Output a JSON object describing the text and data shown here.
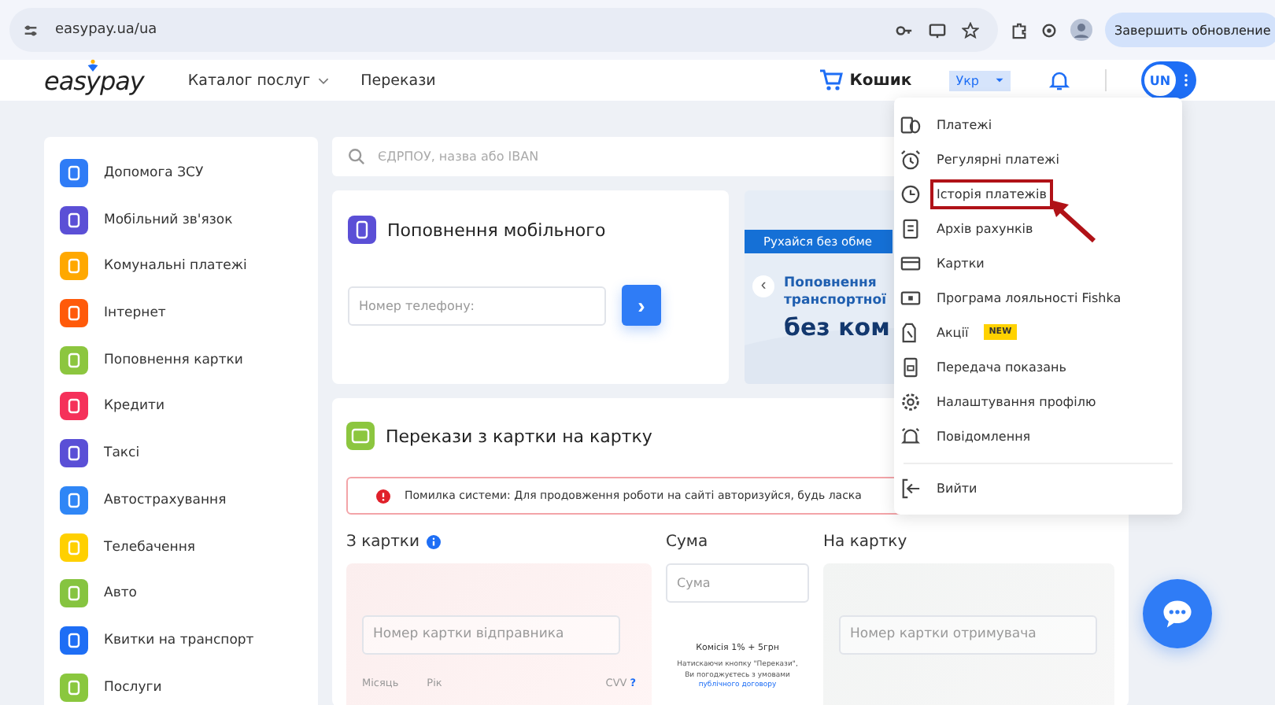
{
  "browser": {
    "url": "easypay.ua/ua",
    "update_button": "Завершить обновление"
  },
  "header": {
    "logo": "easypay",
    "nav": [
      {
        "label": "Каталог послуг",
        "dropdown": true
      },
      {
        "label": "Перекази",
        "dropdown": false
      }
    ],
    "cart": "Кошик",
    "language": "Укр",
    "avatar": "UN"
  },
  "sidebar": {
    "items": [
      {
        "label": "Допомога ЗСУ",
        "color": "#2f7cf6"
      },
      {
        "label": "Мобільний зв'язок",
        "color": "#5b4fd6"
      },
      {
        "label": "Комунальні платежі",
        "color": "#ffa800"
      },
      {
        "label": "Інтернет",
        "color": "#ff5a0a"
      },
      {
        "label": "Поповнення картки",
        "color": "#8cc63f"
      },
      {
        "label": "Кредити",
        "color": "#f5315a"
      },
      {
        "label": "Таксі",
        "color": "#5a4fd6"
      },
      {
        "label": "Автострахування",
        "color": "#2f86f6"
      },
      {
        "label": "Телебачення",
        "color": "#ffd000"
      },
      {
        "label": "Авто",
        "color": "#86c440"
      },
      {
        "label": "Квитки на транспорт",
        "color": "#1e6ef5"
      },
      {
        "label": "Послуги",
        "color": "#8ac73e"
      }
    ]
  },
  "search": {
    "placeholder": "ЄДРПОУ, назва або IBAN"
  },
  "mobile_topup": {
    "title": "Поповнення мобільного",
    "phone_placeholder": "Номер телефону:",
    "submit": "›"
  },
  "banner": {
    "tag": "Рухайся без обме",
    "prev": "‹",
    "lines": [
      "Поповнення",
      "транспортної"
    ],
    "headline": "без ком"
  },
  "transfer": {
    "title": "Перекази з картки на картку",
    "error": "Помилка системи: Для продовження роботи на сайті авторизуйся, будь ласка",
    "from_label": "З картки",
    "from_placeholder": "Номер картки відправника",
    "month": "Місяць",
    "year": "Рік",
    "cvv": "CVV",
    "cvv_help": "?",
    "amount_label": "Сума",
    "amount_placeholder": "Сума",
    "commission": "Комісія 1% + 5грн",
    "terms": "Натискаючи кнопку \"Перекази\", Ви погоджуєтесь з умовами",
    "terms_link": "публічного договору",
    "to_label": "На картку",
    "to_placeholder": "Номер картки отримувача"
  },
  "user_menu": {
    "items": [
      {
        "label": "Платежі",
        "kind": "coins",
        "highlighted": false
      },
      {
        "label": "Регулярні платежі",
        "kind": "alarm",
        "highlighted": false
      },
      {
        "label": "Історія платежів",
        "kind": "history",
        "highlighted": true
      },
      {
        "label": "Архів рахунків",
        "kind": "document",
        "highlighted": false
      },
      {
        "label": "Картки",
        "kind": "card",
        "highlighted": false
      },
      {
        "label": "Програма лояльності Fishka",
        "kind": "loyalty",
        "highlighted": false
      },
      {
        "label": "Акції",
        "kind": "tag",
        "highlighted": false,
        "badge": "NEW"
      },
      {
        "label": "Передача показань",
        "kind": "meter",
        "highlighted": false
      },
      {
        "label": "Налаштування профілю",
        "kind": "gear",
        "highlighted": false
      },
      {
        "label": "Повідомлення",
        "kind": "bell",
        "highlighted": false
      }
    ],
    "logout": "Вийти"
  }
}
